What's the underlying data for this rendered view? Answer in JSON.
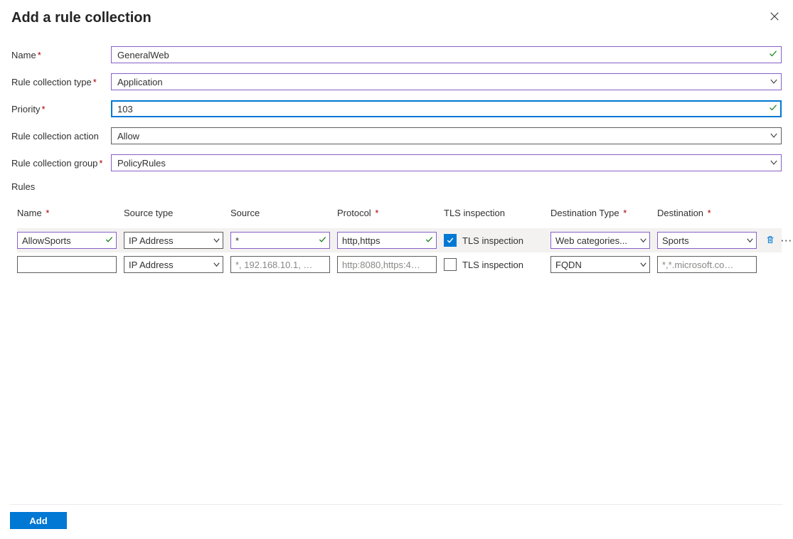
{
  "title": "Add a rule collection",
  "labels": {
    "name": "Name",
    "rule_collection_type": "Rule collection type",
    "priority": "Priority",
    "rule_collection_action": "Rule collection action",
    "rule_collection_group": "Rule collection group",
    "rules": "Rules"
  },
  "values": {
    "name": "GeneralWeb",
    "rule_collection_type": "Application",
    "priority": "103",
    "rule_collection_action": "Allow",
    "rule_collection_group": "PolicyRules"
  },
  "rules_columns": {
    "name": "Name",
    "source_type": "Source type",
    "source": "Source",
    "protocol": "Protocol",
    "tls_inspection": "TLS inspection",
    "destination_type": "Destination Type",
    "destination": "Destination"
  },
  "rules": {
    "row1": {
      "name": "AllowSports",
      "source_type": "IP Address",
      "source": "*",
      "protocol": "http,https",
      "tls_checked": true,
      "tls_label": "TLS inspection",
      "destination_type": "Web categories...",
      "destination": "Sports"
    },
    "row2": {
      "name": "",
      "source_type": "IP Address",
      "source_placeholder": "*, 192.168.10.1, 192...",
      "protocol_placeholder": "http:8080,https:443",
      "tls_checked": false,
      "tls_label": "TLS inspection",
      "destination_type": "FQDN",
      "destination_placeholder": "*,*.microsoft.com,*..."
    }
  },
  "footer": {
    "add": "Add"
  }
}
